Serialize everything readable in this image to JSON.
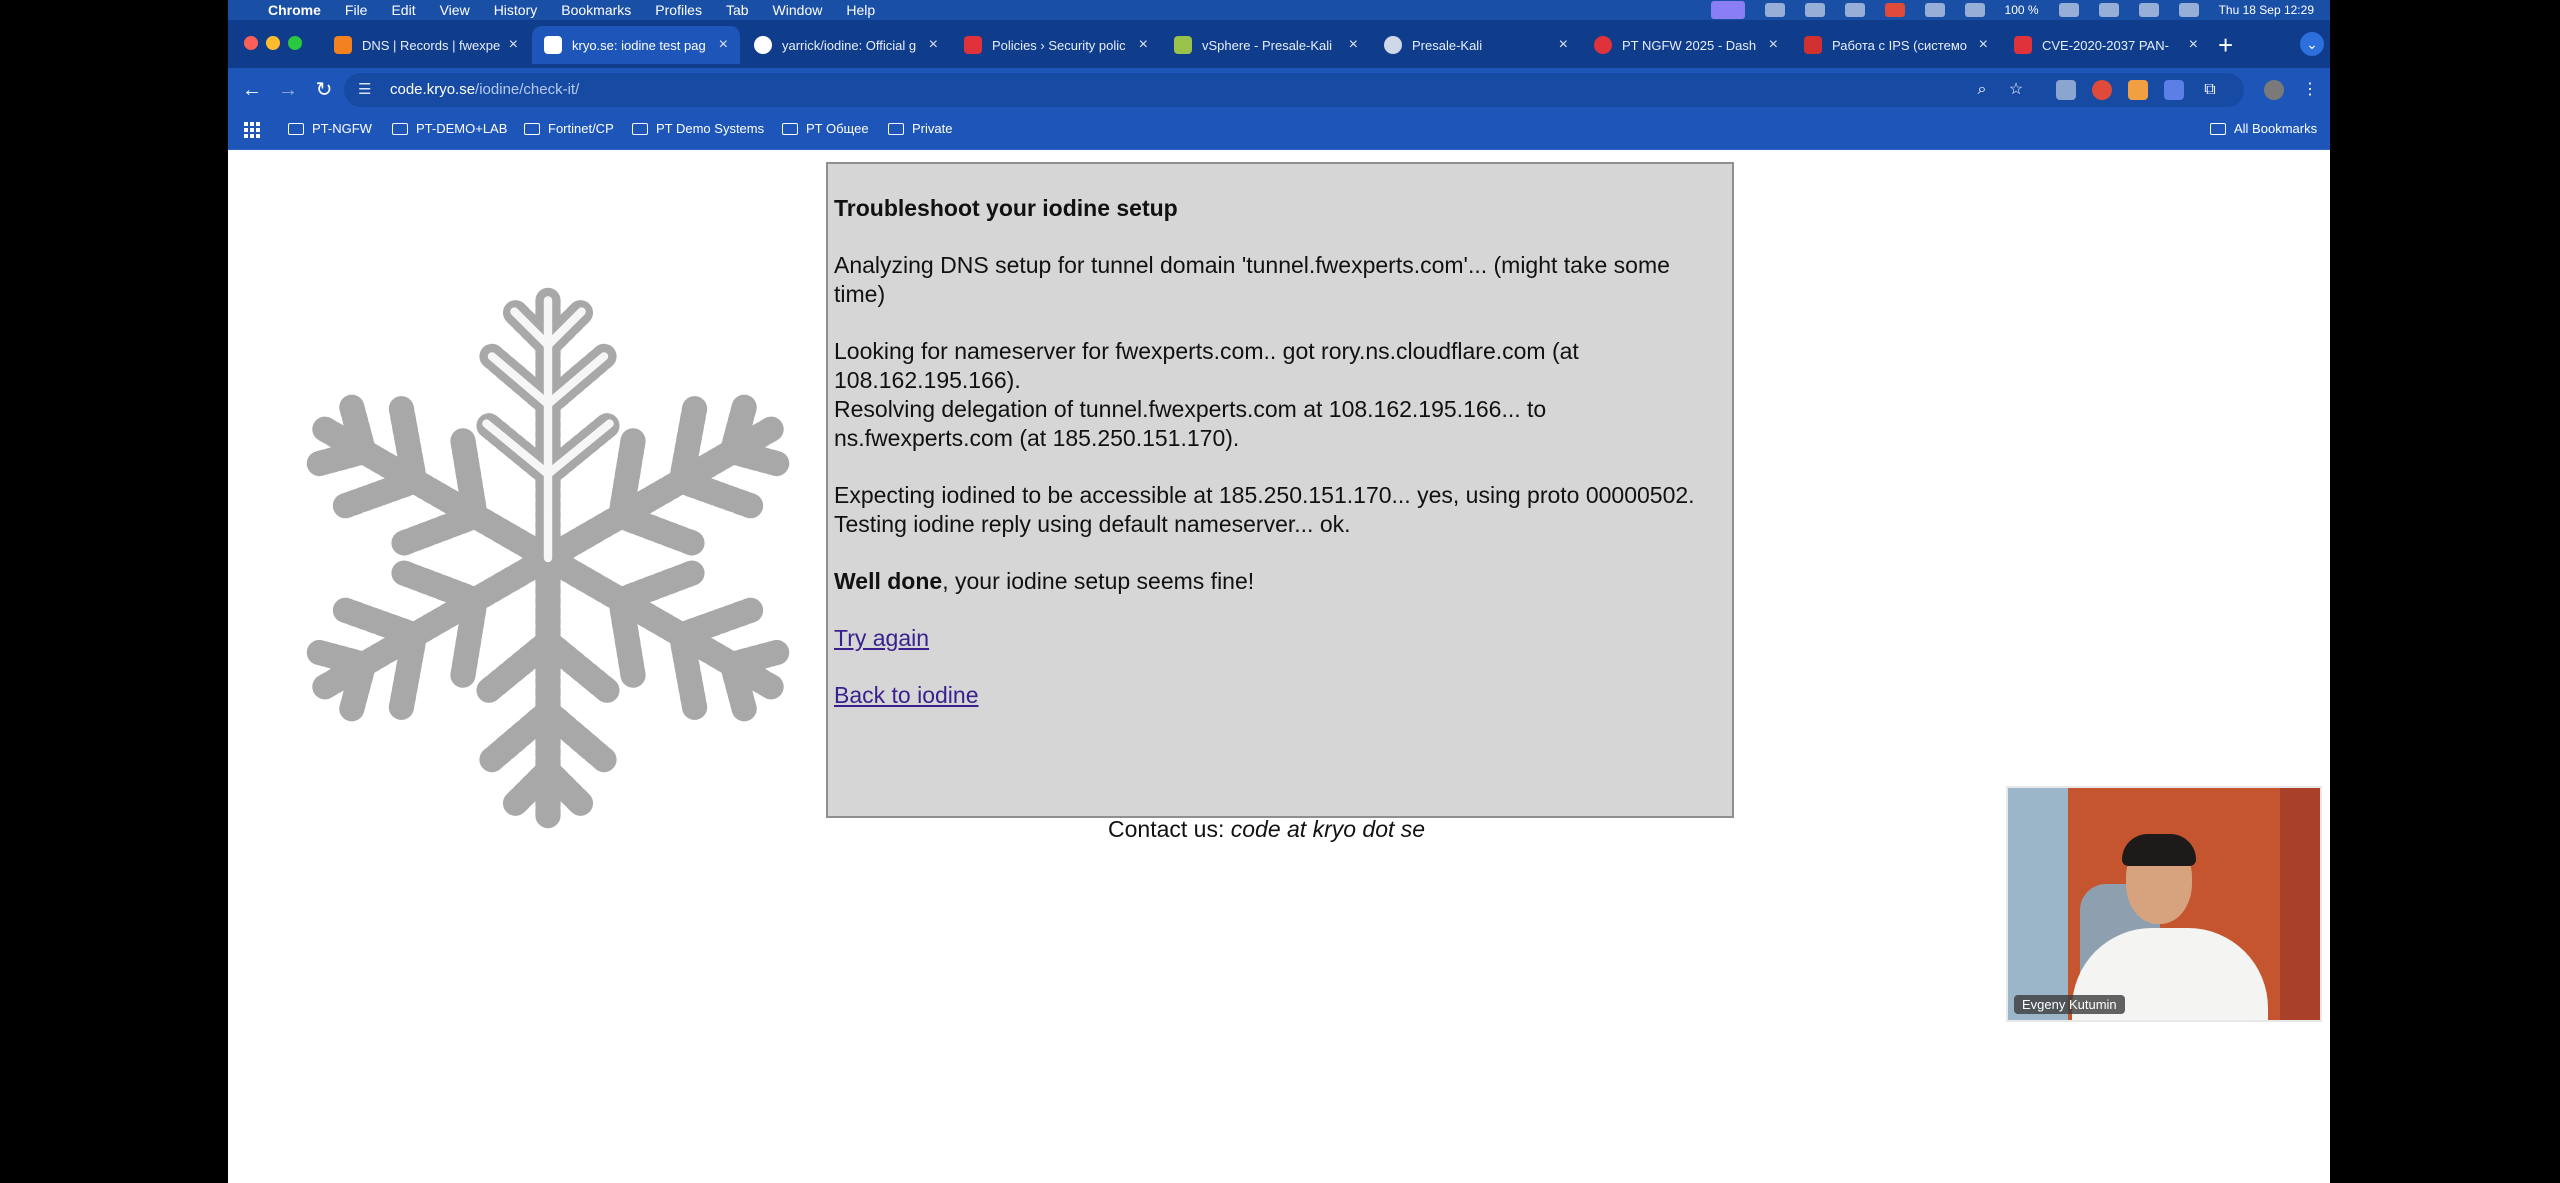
{
  "menubar": {
    "app": "Chrome",
    "items": [
      "File",
      "Edit",
      "View",
      "History",
      "Bookmarks",
      "Profiles",
      "Tab",
      "Window",
      "Help"
    ],
    "battery": "100 %",
    "clock": "Thu 18 Sep 12:29"
  },
  "tabs": [
    {
      "label": "DNS | Records | fwexpe",
      "active": false,
      "favicon_color": "#f48120"
    },
    {
      "label": "kryo.se: iodine test pag",
      "active": true,
      "favicon_color": "#ffffff"
    },
    {
      "label": "yarrick/iodine: Official g",
      "active": false,
      "favicon_color": "#ffffff"
    },
    {
      "label": "Policies › Security polic",
      "active": false,
      "favicon_color": "#e0323a"
    },
    {
      "label": "vSphere - Presale-Kali",
      "active": false,
      "favicon_color": "#9ac24a"
    },
    {
      "label": "Presale-Kali",
      "active": false,
      "favicon_color": "#cfd8e8"
    },
    {
      "label": "PT NGFW 2025 - Dash",
      "active": false,
      "favicon_color": "#e0323a"
    },
    {
      "label": "Работа с IPS (системо",
      "active": false,
      "favicon_color": "#d03030"
    },
    {
      "label": "CVE-2020-2037 PAN-",
      "active": false,
      "favicon_color": "#e0323a"
    }
  ],
  "toolbar": {
    "url_host": "code.kryo.se",
    "url_path": "/iodine/check-it/"
  },
  "bookmarks": {
    "folders": [
      "PT-NGFW",
      "PT-DEMO+LAB",
      "Fortinet/CP",
      "PT Demo Systems",
      "PT Общее",
      "Private"
    ],
    "all": "All Bookmarks"
  },
  "check": {
    "title": "Troubleshoot your iodine setup",
    "analyzing": "Analyzing DNS setup for tunnel domain 'tunnel.fwexperts.com'... (might take some time)",
    "nameserver": "Looking for nameserver for fwexperts.com.. got rory.ns.cloudflare.com (at 108.162.195.166).",
    "delegation": "Resolving delegation of tunnel.fwexperts.com at 108.162.195.166... to ns.fwexperts.com (at 185.250.151.170).",
    "expecting": "Expecting iodined to be accessible at 185.250.151.170... yes, using proto 00000502.",
    "testing": "Testing iodine reply using default nameserver... ok.",
    "well_done": "Well done",
    "result_rest": ", your iodine setup seems fine!",
    "try_again": "Try again",
    "back": "Back to iodine"
  },
  "contact": {
    "label": "Contact us:",
    "address": "code at kryo dot se"
  },
  "webcam": {
    "name": "Evgeny Kutumin"
  }
}
